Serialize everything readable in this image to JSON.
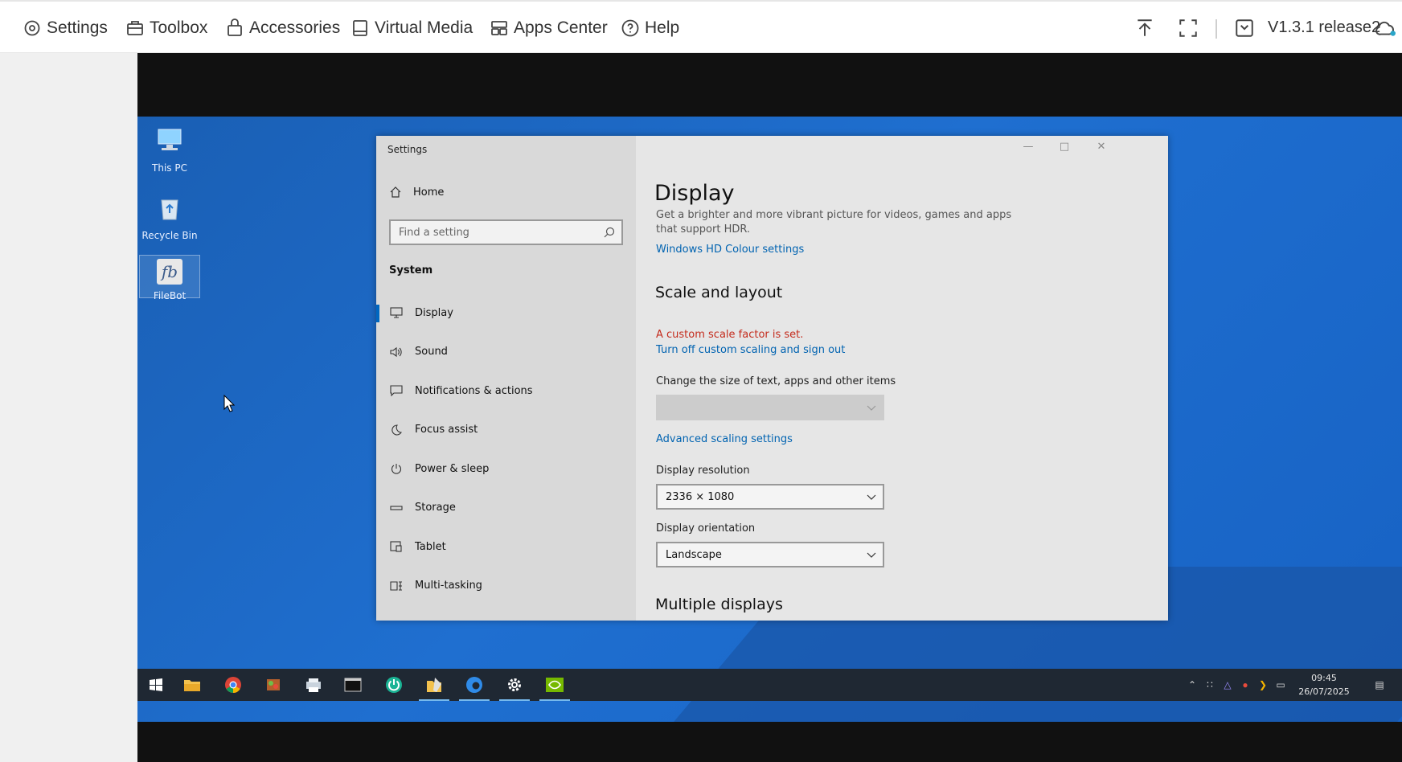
{
  "toolbar": {
    "menu": [
      "Settings",
      "Toolbox",
      "Accessories",
      "Virtual Media",
      "Apps Center",
      "Help"
    ],
    "version": "V1.3.1 release2"
  },
  "desktop": {
    "icons": [
      "This PC",
      "Recycle Bin",
      "FileBot"
    ]
  },
  "settings_window": {
    "title": "Settings",
    "home": "Home",
    "search_placeholder": "Find a setting",
    "section": "System",
    "nav": [
      "Display",
      "Sound",
      "Notifications & actions",
      "Focus assist",
      "Power & sleep",
      "Storage",
      "Tablet",
      "Multi-tasking"
    ],
    "active_nav": "Display",
    "page_title": "Display",
    "hdr_desc": "Get a brighter and more vibrant picture for videos, games and apps that support HDR.",
    "hdr_link": "Windows HD Colour settings",
    "scale_heading": "Scale and layout",
    "scale_warning": "A custom scale factor is set.",
    "scale_link": "Turn off custom scaling and sign out",
    "size_label": "Change the size of text, apps and other items",
    "size_value": "",
    "advanced_link": "Advanced scaling settings",
    "resolution_label": "Display resolution",
    "resolution_value": "2336 × 1080",
    "orientation_label": "Display orientation",
    "orientation_value": "Landscape",
    "multiple_heading": "Multiple displays"
  },
  "taskbar": {
    "apps": [
      "start-icon",
      "file-explorer-icon",
      "chrome-icon",
      "app-icon",
      "printer-icon",
      "terminal-icon",
      "power-app-icon",
      "filebot-app-icon",
      "edge-icon",
      "settings-gear-icon",
      "nvidia-icon"
    ],
    "time": "09:45",
    "date": "26/07/2025"
  }
}
